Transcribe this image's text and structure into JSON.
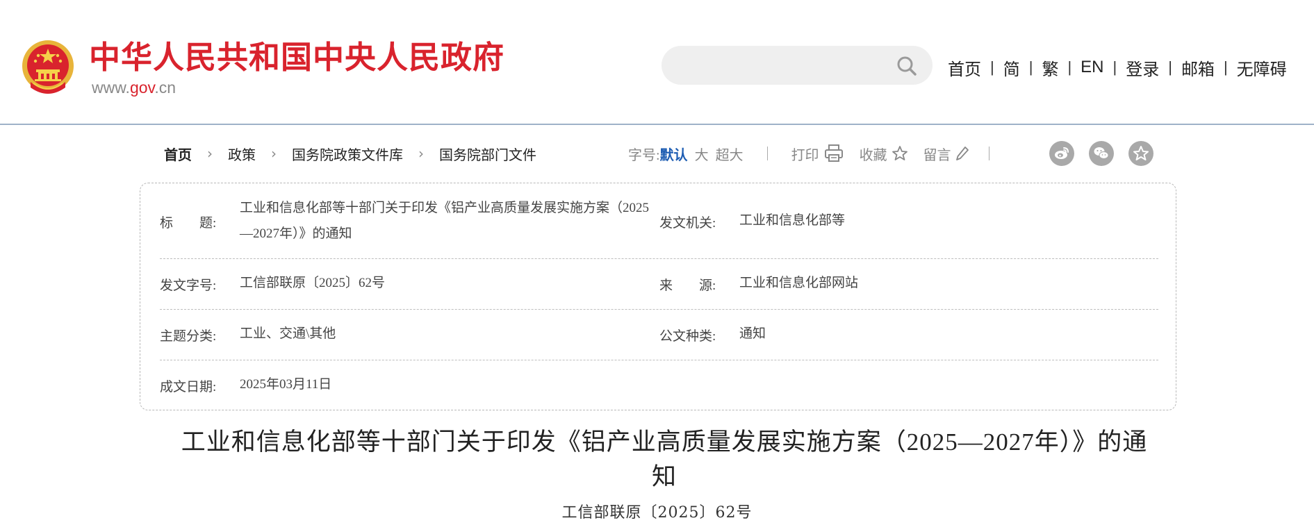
{
  "header": {
    "site_title": "中华人民共和国中央人民政府",
    "site_url_prefix": "www.",
    "site_url_accent": "gov",
    "site_url_suffix": ".cn",
    "search_placeholder": "",
    "nav": [
      "首页",
      "简",
      "繁",
      "EN",
      "登录",
      "邮箱",
      "无障碍"
    ],
    "nav_separator": "|"
  },
  "breadcrumb": {
    "items": [
      "首页",
      "政策",
      "国务院政策文件库",
      "国务院部门文件"
    ],
    "separator": "›"
  },
  "toolbar": {
    "font_size_label": "字号:",
    "font_sizes": [
      "默认",
      "大",
      "超大"
    ],
    "print_label": "打印",
    "favorite_label": "收藏",
    "comment_label": "留言"
  },
  "info": {
    "title_label": "标　　题:",
    "title_value": "工业和信息化部等十部门关于印发《铝产业高质量发展实施方案（2025—2027年）》的通知",
    "issuer_label": "发文机关:",
    "issuer_value": "工业和信息化部等",
    "doc_no_label": "发文字号:",
    "doc_no_value": "工信部联原〔2025〕62号",
    "source_label": "来　　源:",
    "source_value": "工业和信息化部网站",
    "topic_label": "主题分类:",
    "topic_value": "工业、交通\\其他",
    "doc_type_label": "公文种类:",
    "doc_type_value": "通知",
    "date_label": "成文日期:",
    "date_value": "2025年03月11日"
  },
  "article": {
    "title": "工业和信息化部等十部门关于印发《铝产业高质量发展实施方案（2025—2027年）》的通知",
    "doc_number": "工信部联原〔2025〕62号"
  },
  "colors": {
    "brand_red": "#d9232d",
    "link_blue": "#1f5eb3",
    "icon_gray": "#a9a9a9"
  },
  "icons": [
    "national-emblem-icon",
    "search-icon",
    "printer-icon",
    "star-icon",
    "pencil-icon",
    "weibo-icon",
    "wechat-icon",
    "favorite-star-icon"
  ]
}
